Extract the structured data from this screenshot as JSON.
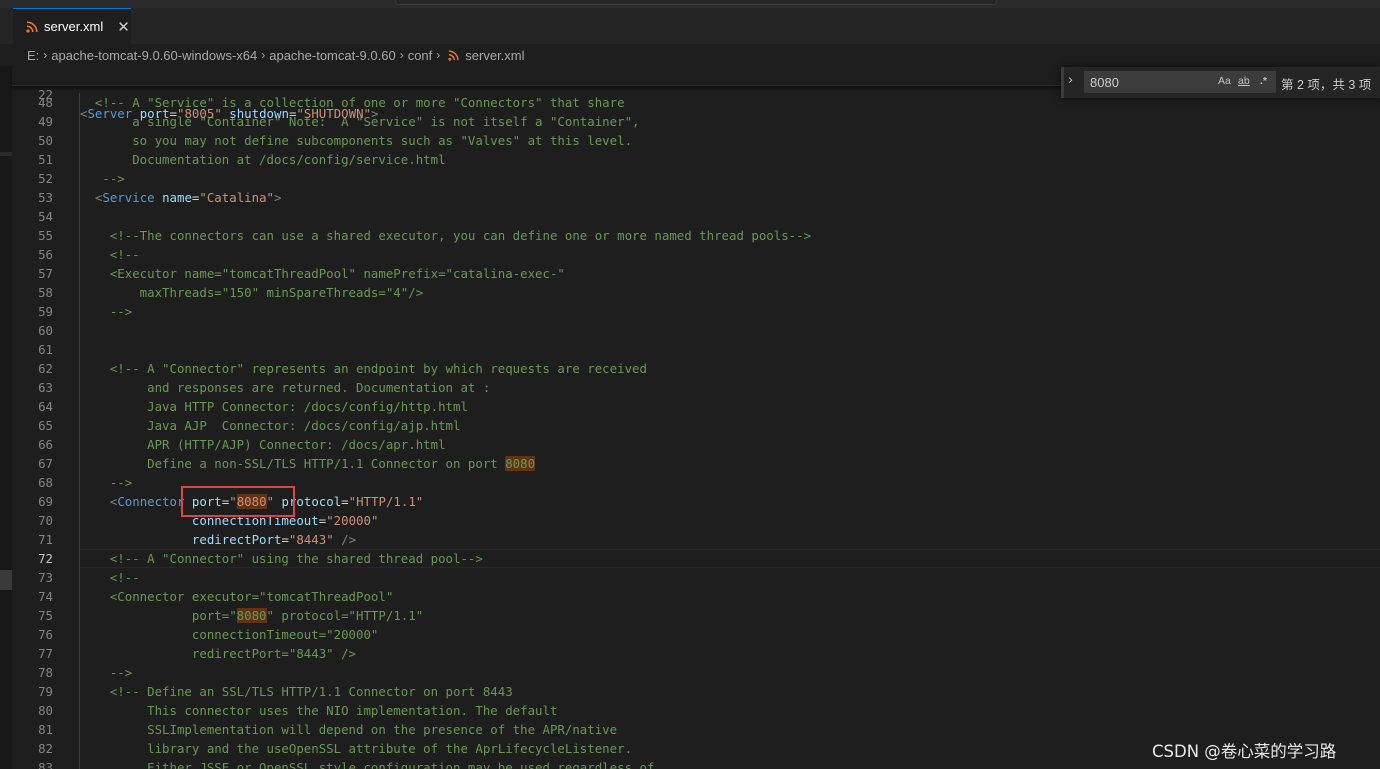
{
  "editor_tab": {
    "label": "server.xml",
    "close_glyph": "✕",
    "icon": "rss-xml-file-icon"
  },
  "breadcrumb": {
    "items": [
      "E:",
      "apache-tomcat-9.0.60-windows-x64",
      "apache-tomcat-9.0.60",
      "conf",
      "server.xml"
    ],
    "separator": "›"
  },
  "sticky_scroll": {
    "number": "22",
    "segments": [
      {
        "text": "<",
        "c": "p"
      },
      {
        "text": "Server",
        "c": "t"
      },
      {
        "text": " ",
        "c": "w"
      },
      {
        "text": "port",
        "c": "a"
      },
      {
        "text": "=",
        "c": "w"
      },
      {
        "text": "\"8005\"",
        "c": "s"
      },
      {
        "text": " ",
        "c": "w"
      },
      {
        "text": "shutdown",
        "c": "a"
      },
      {
        "text": "=",
        "c": "w"
      },
      {
        "text": "\"SHUTDOWN\"",
        "c": "s"
      },
      {
        "text": ">",
        "c": "p"
      }
    ]
  },
  "find_widget": {
    "toggle_glyph": "›",
    "query": "8080",
    "match_case": "Aa",
    "whole_word": "ab",
    "regex": ".*",
    "result_count": "第 2 项，共 3 项"
  },
  "code_lines": [
    {
      "n": "48",
      "seg": [
        {
          "t": "  <!-- A \"Service\" is a collection of one or more \"Connectors\" that share",
          "c": "c"
        }
      ]
    },
    {
      "n": "49",
      "seg": [
        {
          "t": "       a single \"Container\" Note:  A \"Service\" is not itself a \"Container\",",
          "c": "c"
        }
      ]
    },
    {
      "n": "50",
      "seg": [
        {
          "t": "       so you may not define subcomponents such as \"Valves\" at this level.",
          "c": "c"
        }
      ]
    },
    {
      "n": "51",
      "seg": [
        {
          "t": "       Documentation at /docs/config/service.html",
          "c": "c"
        }
      ]
    },
    {
      "n": "52",
      "seg": [
        {
          "t": "   -->",
          "c": "c"
        }
      ]
    },
    {
      "n": "53",
      "seg": [
        {
          "t": "  ",
          "c": "w"
        },
        {
          "t": "<",
          "c": "p"
        },
        {
          "t": "Service",
          "c": "t"
        },
        {
          "t": " ",
          "c": "w"
        },
        {
          "t": "name",
          "c": "a"
        },
        {
          "t": "=",
          "c": "w"
        },
        {
          "t": "\"Catalina\"",
          "c": "s"
        },
        {
          "t": ">",
          "c": "p"
        }
      ]
    },
    {
      "n": "54",
      "seg": []
    },
    {
      "n": "55",
      "seg": [
        {
          "t": "    <!--The connectors can use a shared executor, you can define one or more named thread pools-->",
          "c": "c"
        }
      ]
    },
    {
      "n": "56",
      "seg": [
        {
          "t": "    <!--",
          "c": "c"
        }
      ]
    },
    {
      "n": "57",
      "seg": [
        {
          "t": "    <Executor name=\"tomcatThreadPool\" namePrefix=\"catalina-exec-\"",
          "c": "c"
        }
      ]
    },
    {
      "n": "58",
      "seg": [
        {
          "t": "        maxThreads=\"150\" minSpareThreads=\"4\"/>",
          "c": "c"
        }
      ]
    },
    {
      "n": "59",
      "seg": [
        {
          "t": "    -->",
          "c": "c"
        }
      ]
    },
    {
      "n": "60",
      "seg": []
    },
    {
      "n": "61",
      "seg": []
    },
    {
      "n": "62",
      "seg": [
        {
          "t": "    <!-- A \"Connector\" represents an endpoint by which requests are received",
          "c": "c"
        }
      ]
    },
    {
      "n": "63",
      "seg": [
        {
          "t": "         and responses are returned. Documentation at :",
          "c": "c"
        }
      ]
    },
    {
      "n": "64",
      "seg": [
        {
          "t": "         Java HTTP Connector: /docs/config/http.html",
          "c": "c"
        }
      ]
    },
    {
      "n": "65",
      "seg": [
        {
          "t": "         Java AJP  Connector: /docs/config/ajp.html",
          "c": "c"
        }
      ]
    },
    {
      "n": "66",
      "seg": [
        {
          "t": "         APR (HTTP/AJP) Connector: /docs/apr.html",
          "c": "c"
        }
      ]
    },
    {
      "n": "67",
      "seg": [
        {
          "t": "         Define a non-SSL/TLS HTTP/1.1 Connector on port ",
          "c": "c"
        },
        {
          "t": "8080",
          "c": "c",
          "hl": true
        }
      ]
    },
    {
      "n": "68",
      "seg": [
        {
          "t": "    -->",
          "c": "c"
        }
      ]
    },
    {
      "n": "69",
      "seg": [
        {
          "t": "    ",
          "c": "w"
        },
        {
          "t": "<",
          "c": "p"
        },
        {
          "t": "Connector",
          "c": "t"
        },
        {
          "t": " ",
          "c": "w"
        },
        {
          "t": "port",
          "c": "a"
        },
        {
          "t": "=",
          "c": "w"
        },
        {
          "t": "\"",
          "c": "s"
        },
        {
          "t": "8080",
          "c": "s",
          "hl": true
        },
        {
          "t": "\"",
          "c": "s"
        },
        {
          "t": " ",
          "c": "w"
        },
        {
          "t": "protocol",
          "c": "a"
        },
        {
          "t": "=",
          "c": "w"
        },
        {
          "t": "\"HTTP/1.1\"",
          "c": "s"
        }
      ]
    },
    {
      "n": "70",
      "seg": [
        {
          "t": "               ",
          "c": "w"
        },
        {
          "t": "connectionTimeout",
          "c": "a"
        },
        {
          "t": "=",
          "c": "w"
        },
        {
          "t": "\"20000\"",
          "c": "s"
        }
      ]
    },
    {
      "n": "71",
      "seg": [
        {
          "t": "               ",
          "c": "w"
        },
        {
          "t": "redirectPort",
          "c": "a"
        },
        {
          "t": "=",
          "c": "w"
        },
        {
          "t": "\"8443\"",
          "c": "s"
        },
        {
          "t": " ",
          "c": "w"
        },
        {
          "t": "/>",
          "c": "p"
        }
      ]
    },
    {
      "n": "72",
      "active": true,
      "seg": [
        {
          "t": "    <!-- A \"Connector\" using the shared thread pool-->",
          "c": "c"
        }
      ]
    },
    {
      "n": "73",
      "seg": [
        {
          "t": "    <!--",
          "c": "c"
        }
      ]
    },
    {
      "n": "74",
      "seg": [
        {
          "t": "    <Connector executor=\"tomcatThreadPool\"",
          "c": "c"
        }
      ]
    },
    {
      "n": "75",
      "seg": [
        {
          "t": "               port=\"",
          "c": "c"
        },
        {
          "t": "8080",
          "c": "c",
          "hl": true
        },
        {
          "t": "\" protocol=\"HTTP/1.1\"",
          "c": "c"
        }
      ]
    },
    {
      "n": "76",
      "seg": [
        {
          "t": "               connectionTimeout=\"20000\"",
          "c": "c"
        }
      ]
    },
    {
      "n": "77",
      "seg": [
        {
          "t": "               redirectPort=\"8443\" />",
          "c": "c"
        }
      ]
    },
    {
      "n": "78",
      "seg": [
        {
          "t": "    -->",
          "c": "c"
        }
      ]
    },
    {
      "n": "79",
      "seg": [
        {
          "t": "    <!-- Define an SSL/TLS HTTP/1.1 Connector on port 8443",
          "c": "c"
        }
      ]
    },
    {
      "n": "80",
      "seg": [
        {
          "t": "         This connector uses the NIO implementation. The default",
          "c": "c"
        }
      ]
    },
    {
      "n": "81",
      "seg": [
        {
          "t": "         SSLImplementation will depend on the presence of the APR/native",
          "c": "c"
        }
      ]
    },
    {
      "n": "82",
      "seg": [
        {
          "t": "         library and the useOpenSSL attribute of the AprLifecycleListener.",
          "c": "c"
        }
      ]
    },
    {
      "n": "83",
      "seg": [
        {
          "t": "         Either JSSE or OpenSSL style configuration may be used regardless of",
          "c": "c"
        }
      ]
    }
  ],
  "watermark": "CSDN @卷心菜的学习路"
}
